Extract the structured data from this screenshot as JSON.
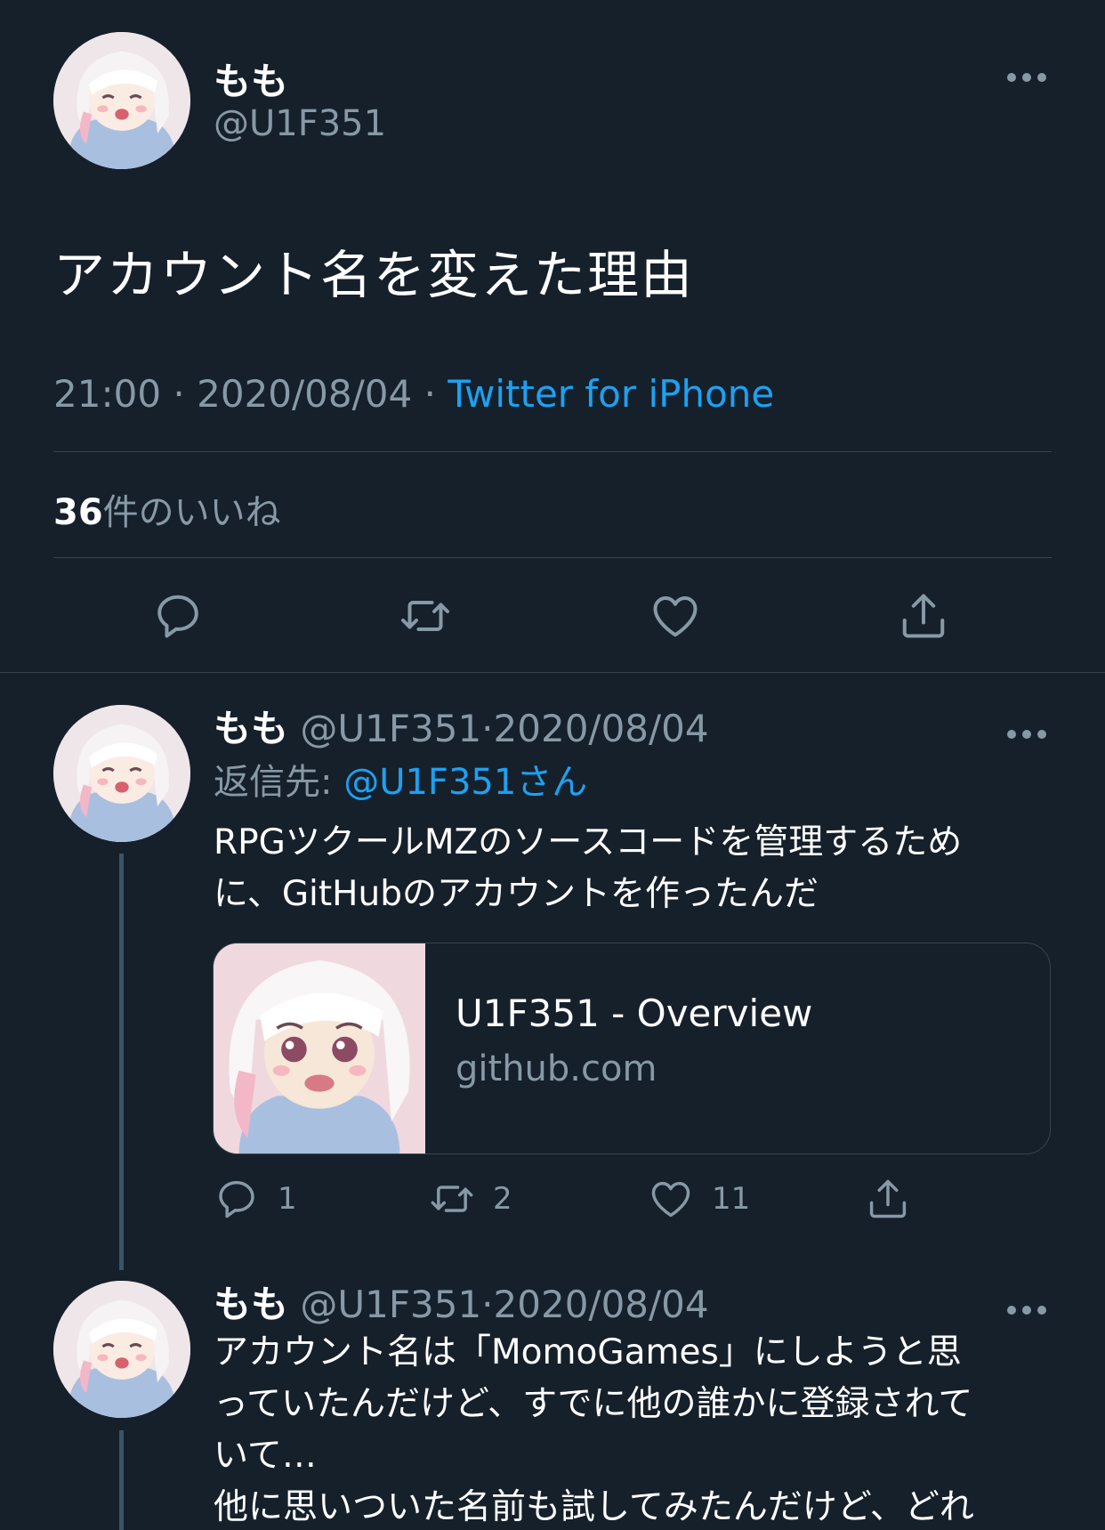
{
  "main_tweet": {
    "display_name": "もも",
    "handle": "@U1F351",
    "text": "アカウント名を変えた理由",
    "time": "21:00",
    "separator": "·",
    "date": "2020/08/04",
    "source": "Twitter for iPhone",
    "like_count": "36",
    "like_label": "件のいいね"
  },
  "thread": [
    {
      "display_name": "もも",
      "handle": "@U1F351",
      "separator": "·",
      "date": "2020/08/04",
      "reply_to_label": "返信先: ",
      "reply_to_mention": "@U1F351さん",
      "text_lines": [
        "RPGツクールMZのソースコードを管理するため",
        "に、GitHubのアカウントを作ったんだ"
      ],
      "card": {
        "title": "U1F351 - Overview",
        "domain": "github.com"
      },
      "reply_count": "1",
      "retweet_count": "2",
      "like_count": "11"
    },
    {
      "display_name": "もも",
      "handle": "@U1F351",
      "separator": "·",
      "date": "2020/08/04",
      "text_lines": [
        "アカウント名は「MomoGames」にしようと思",
        "っていたんだけど、すでに他の誰かに登録されて",
        "いて…",
        "他に思いついた名前も試してみたんだけど、どれ"
      ]
    }
  ],
  "colors": {
    "background": "#15202b",
    "secondary_text": "#8899a6",
    "accent": "#1da1f2",
    "border": "#38444d"
  },
  "icons": [
    "more-icon",
    "reply-icon",
    "retweet-icon",
    "like-icon",
    "share-icon"
  ]
}
